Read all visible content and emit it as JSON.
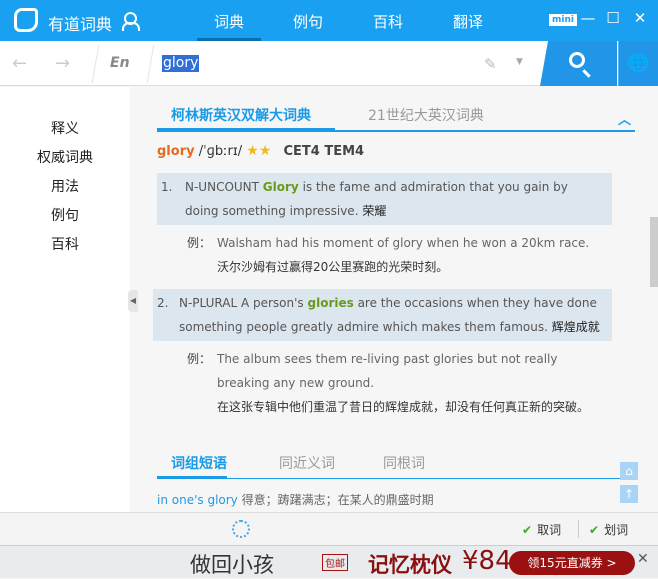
{
  "app": {
    "title": "有道词典",
    "logo": "8"
  },
  "nav": {
    "tabs": [
      "词典",
      "例句",
      "百科",
      "翻译"
    ],
    "active": 0
  },
  "window": {
    "mini": "mini",
    "minimize": "—",
    "maximize": "☐",
    "close": "✕"
  },
  "search": {
    "lang": "En",
    "query": "glory"
  },
  "sidebar": {
    "items": [
      "释义",
      "权威词典",
      "用法",
      "例句",
      "百科"
    ]
  },
  "dict_tabs": [
    "柯林斯英汉双解大词典",
    "21世纪大英汉词典"
  ],
  "entry": {
    "word": "glory",
    "phonetic": "/ˈɡbːrɪ/",
    "stars": "★★",
    "tags": "CET4 TEM4"
  },
  "definitions": [
    {
      "num": "1.",
      "pre": "N-UNCOUNT ",
      "hl": "Glory",
      "post": " is the fame and admiration that you gain by doing something impressive. ",
      "zh": "荣耀",
      "example_label": "例：",
      "example_en": "Walsham had his moment of glory when he won a 20km race.",
      "example_zh": "沃尔沙姆有过赢得20公里赛跑的光荣时刻。"
    },
    {
      "num": "2.",
      "pre": "N-PLURAL A person's ",
      "hl": "glories",
      "post": " are the occasions when they have done something people greatly admire which makes them famous. ",
      "zh": "辉煌成就",
      "example_label": "例：",
      "example_en": "The album sees them re-living past glories but not really breaking any new ground.",
      "example_zh": "在这张专辑中他们重温了昔日的辉煌成就，却没有任何真正新的突破。"
    }
  ],
  "sub_tabs": [
    "词组短语",
    "同近义词",
    "同根词"
  ],
  "phrase": {
    "en": "in one's glory",
    "zh": "得意；踌躇满志；在某人的鼎盛时期"
  },
  "bottom": {
    "pick_word": "取词",
    "select_word": "划词"
  },
  "ad": {
    "text": "做回小孩",
    "badge": "包邮",
    "brand": "记忆枕仪",
    "price": "¥84",
    "button": "领15元直减券 >",
    "close": "✕"
  }
}
